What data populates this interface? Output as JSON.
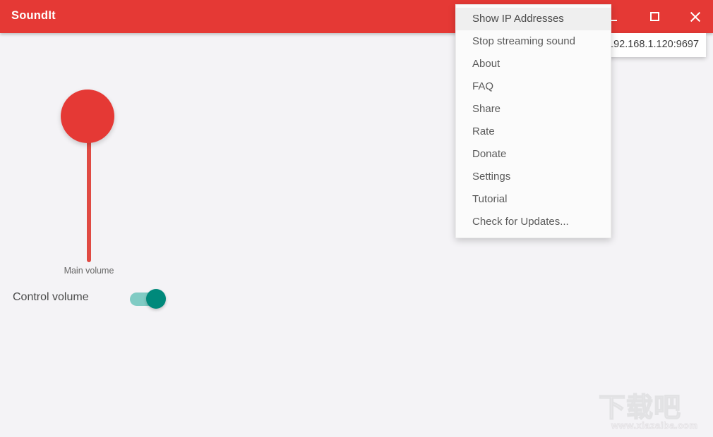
{
  "window": {
    "title": "SoundIt",
    "accent_color": "#e53935",
    "body_color": "#f4f3f6",
    "controls": {
      "minimize": "minimize",
      "maximize": "maximize",
      "close": "close"
    }
  },
  "ip_popup": {
    "address": "192.168.1.120:9697"
  },
  "main": {
    "slider": {
      "label": "Main volume",
      "orientation": "vertical",
      "thumb_color": "#e53935",
      "track_color": "#e04a43"
    },
    "control_volume": {
      "label": "Control volume",
      "toggle_state": "on",
      "toggle_track_color": "#80cbc4",
      "toggle_knob_color": "#00897b"
    }
  },
  "menu": {
    "items": [
      {
        "label": "Show IP Addresses",
        "highlighted": true
      },
      {
        "label": "Stop streaming sound",
        "highlighted": false
      },
      {
        "label": "About",
        "highlighted": false
      },
      {
        "label": "FAQ",
        "highlighted": false
      },
      {
        "label": "Share",
        "highlighted": false
      },
      {
        "label": "Rate",
        "highlighted": false
      },
      {
        "label": "Donate",
        "highlighted": false
      },
      {
        "label": "Settings",
        "highlighted": false
      },
      {
        "label": "Tutorial",
        "highlighted": false
      },
      {
        "label": "Check for Updates...",
        "highlighted": false
      }
    ]
  },
  "watermark": {
    "mark": "下载吧",
    "url": "www.xiazaiba.com"
  }
}
